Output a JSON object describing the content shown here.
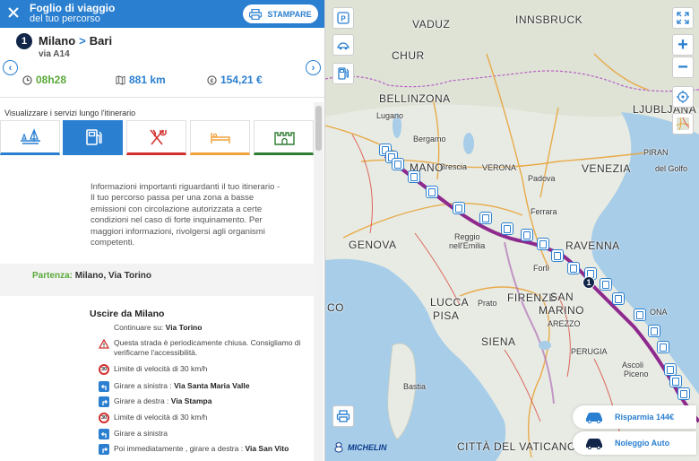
{
  "header": {
    "title": "Foglio di viaggio",
    "subtitle": "del tuo percorso",
    "print_label": "STAMPARE"
  },
  "route": {
    "number": "1",
    "from": "Milano",
    "arrow": ">",
    "to": "Bari",
    "via": "via A14"
  },
  "stats": {
    "time": "08h28",
    "distance": "881 km",
    "cost": "154,21 €"
  },
  "services": {
    "label": "Visualizzare i servizi lungo l'itinerario",
    "items": [
      {
        "name": "weather-icon",
        "color": "#2a7fd0"
      },
      {
        "name": "fuel-icon",
        "color": "#2a7fd0"
      },
      {
        "name": "restaurant-icon",
        "color": "#d32f2f"
      },
      {
        "name": "hotel-icon",
        "color": "#f2a23a"
      },
      {
        "name": "tourism-icon",
        "color": "#2e7d32"
      }
    ]
  },
  "info": {
    "lines": [
      "Informazioni importanti riguardanti il tuo itinerario -",
      "Il tuo percorso passa per una zona a basse",
      "emissioni con circolazione autorizzata a certe",
      "condizioni nel caso di forte inquinamento. Per",
      "maggiori informazioni, rivolgersi agli organismi",
      "competenti."
    ]
  },
  "departure": {
    "label": "Partenza:",
    "value": "Milano, Via Torino"
  },
  "steps": {
    "title": "Uscire da Milano",
    "items": [
      {
        "icon": "none",
        "text": "Continuare su:",
        "bold": "Via Torino"
      },
      {
        "icon": "warning-icon",
        "text": "Questa strada è periodicamente chiusa. Consigliamo di verificarne l'accessibilità.",
        "bold": ""
      },
      {
        "icon": "speed-limit-icon",
        "limit": "30",
        "text": "Limite di velocità di 30 km/h",
        "bold": ""
      },
      {
        "icon": "turn-left-icon",
        "text": "Girare a sinistra :",
        "bold": "Via Santa Maria Valle"
      },
      {
        "icon": "turn-right-icon",
        "text": "Girare a destra :",
        "bold": "Via Stampa"
      },
      {
        "icon": "speed-limit-icon",
        "limit": "30",
        "text": "Limite di velocità di 30 km/h",
        "bold": ""
      },
      {
        "icon": "turn-left-icon",
        "text": "Girare a sinistra",
        "bold": ""
      },
      {
        "icon": "turn-right-icon",
        "text": "Poi immediatamente , girare a destra :",
        "bold": "Via San Vito"
      }
    ]
  },
  "map": {
    "labels": [
      {
        "text": "VADUZ",
        "cls": "big"
      },
      {
        "text": "INNSBRUCK",
        "cls": "big"
      },
      {
        "text": "CHUR",
        "cls": "big"
      },
      {
        "text": "BELLINZONA",
        "cls": "big"
      },
      {
        "text": "LJUBLJANA",
        "cls": "big"
      },
      {
        "text": "Lugano",
        "cls": "mid"
      },
      {
        "text": "Bergamo",
        "cls": "mid"
      },
      {
        "text": "Brescia",
        "cls": "mid"
      },
      {
        "text": "VERONA",
        "cls": "mid"
      },
      {
        "text": "VENEZIA",
        "cls": "big"
      },
      {
        "text": "PIRAN",
        "cls": "mid"
      },
      {
        "text": "del Golfo",
        "cls": "mid"
      },
      {
        "text": "Padova",
        "cls": "mid"
      },
      {
        "text": "MANO",
        "cls": "big"
      },
      {
        "text": "Ferrara",
        "cls": "mid"
      },
      {
        "text": "GENOVA",
        "cls": "big"
      },
      {
        "text": "Reggio",
        "cls": "mid"
      },
      {
        "text": "nell'Emilia",
        "cls": "mid"
      },
      {
        "text": "RAVENNA",
        "cls": "big"
      },
      {
        "text": "Forlì",
        "cls": "mid"
      },
      {
        "text": "LUCCA",
        "cls": "big"
      },
      {
        "text": "FIRENZE",
        "cls": "big"
      },
      {
        "text": "SAN",
        "cls": "big"
      },
      {
        "text": "MARINO",
        "cls": "big"
      },
      {
        "text": "PISA",
        "cls": "big"
      },
      {
        "text": "Prato",
        "cls": "mid"
      },
      {
        "text": "AREZZO",
        "cls": "mid"
      },
      {
        "text": "CO",
        "cls": "big"
      },
      {
        "text": "SIENA",
        "cls": "big"
      },
      {
        "text": "PERUGIA",
        "cls": "mid"
      },
      {
        "text": "Ascoli",
        "cls": "mid"
      },
      {
        "text": "Piceno",
        "cls": "mid"
      },
      {
        "text": "Bastia",
        "cls": "mid"
      },
      {
        "text": "CITTÀ DEL VATICANO",
        "cls": "big"
      },
      {
        "text": "ONA",
        "cls": "mid"
      }
    ],
    "marker_number": "1",
    "promos": [
      {
        "label": "Risparmia",
        "value": "144€"
      },
      {
        "label": "Noleggio Auto",
        "value": ""
      }
    ],
    "brand": "MICHELIN"
  }
}
